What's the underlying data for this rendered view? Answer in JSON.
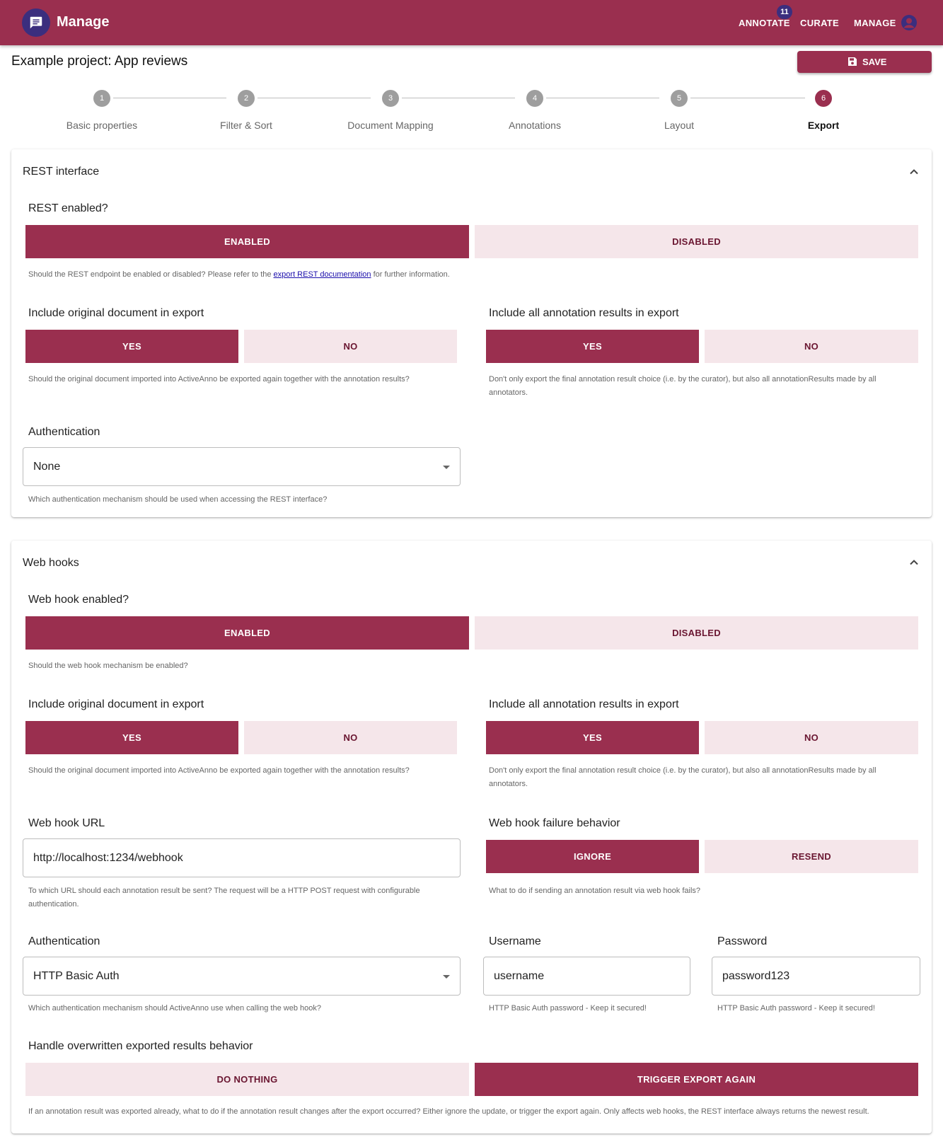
{
  "appbar": {
    "title": "Manage",
    "nav": [
      "ANNOTATE",
      "CURATE",
      "MANAGE"
    ],
    "badge_count": "11"
  },
  "page": {
    "title": "Example project: App reviews",
    "save_label": "SAVE"
  },
  "stepper": {
    "steps": [
      {
        "number": "1",
        "label": "Basic properties"
      },
      {
        "number": "2",
        "label": "Filter & Sort"
      },
      {
        "number": "3",
        "label": "Document Mapping"
      },
      {
        "number": "4",
        "label": "Annotations"
      },
      {
        "number": "5",
        "label": "Layout"
      },
      {
        "number": "6",
        "label": "Export"
      }
    ],
    "active_step": 6
  },
  "rest": {
    "title": "REST interface",
    "enabled_question": "REST enabled?",
    "enabled_label": "ENABLED",
    "disabled_label": "DISABLED",
    "enabled_help_before": "Should the REST endpoint be enabled or disabled? Please refer to the ",
    "enabled_help_link": "export REST documentation",
    "enabled_help_after": " for further information.",
    "include_doc_label": "Include original document in export",
    "include_doc_yes": "YES",
    "include_doc_no": "NO",
    "include_doc_help": "Should the original document imported into ActiveAnno be exported again together with the annotation results?",
    "include_all_label": "Include all annotation results in export",
    "include_all_yes": "YES",
    "include_all_no": "NO",
    "include_all_help": "Don't only export the final annotation result choice (i.e. by the curator), but also all annotationResults made by all annotators.",
    "auth_label": "Authentication",
    "auth_value": "None",
    "auth_help": "Which authentication mechanism should be used when accessing the REST interface?"
  },
  "webhooks": {
    "title": "Web hooks",
    "enabled_question": "Web hook enabled?",
    "enabled_label": "ENABLED",
    "disabled_label": "DISABLED",
    "enabled_help": "Should the web hook mechanism be enabled?",
    "include_doc_label": "Include original document in export",
    "include_doc_yes": "YES",
    "include_doc_no": "NO",
    "include_doc_help": "Should the original document imported into ActiveAnno be exported again together with the annotation results?",
    "include_all_label": "Include all annotation results in export",
    "include_all_yes": "YES",
    "include_all_no": "NO",
    "include_all_help": "Don't only export the final annotation result choice (i.e. by the curator), but also all annotationResults made by all annotators.",
    "url_label": "Web hook URL",
    "url_value": "http://localhost:1234/webhook",
    "url_help": "To which URL should each annotation result be sent? The request will be a HTTP POST request with configurable authentication.",
    "failure_label": "Web hook failure behavior",
    "failure_ignore": "IGNORE",
    "failure_resend": "RESEND",
    "failure_help": "What to do if sending an annotation result via web hook fails?",
    "auth_label": "Authentication",
    "auth_value": "HTTP Basic Auth",
    "auth_help": "Which authentication mechanism should ActiveAnno use when calling the web hook?",
    "username_label": "Username",
    "username_value": "username",
    "username_help": "HTTP Basic Auth password - Keep it secured!",
    "password_label": "Password",
    "password_value": "password123",
    "password_help": "HTTP Basic Auth password - Keep it secured!",
    "overwrite_label": "Handle overwritten exported results behavior",
    "overwrite_nothing": "DO NOTHING",
    "overwrite_trigger": "TRIGGER EXPORT AGAIN",
    "overwrite_help": "If an annotation result was exported already, what to do if the annotation result changes after the export occurred? Either ignore the update, or trigger the export again. Only affects web hooks, the REST interface always returns the newest result."
  }
}
